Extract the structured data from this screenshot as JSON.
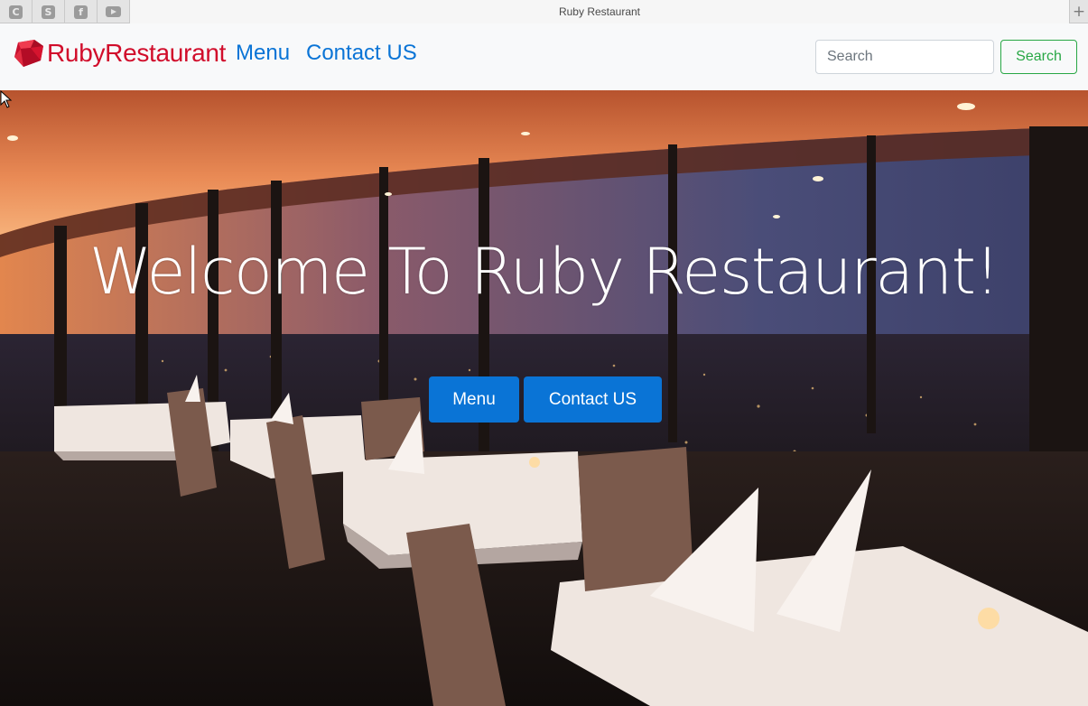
{
  "browser": {
    "tab_title": "Ruby Restaurant",
    "pinned_tabs": [
      {
        "icon": "c-square-icon",
        "glyph": "C"
      },
      {
        "icon": "s-square-icon",
        "glyph": "S"
      },
      {
        "icon": "facebook-icon",
        "glyph": "f"
      },
      {
        "icon": "youtube-icon",
        "glyph": ""
      }
    ],
    "new_tab_glyph": "+"
  },
  "navbar": {
    "brand": "RubyRestaurant",
    "brand_icon": "ruby-gem-icon",
    "links": [
      "Menu",
      "Contact US"
    ],
    "search": {
      "placeholder": "Search",
      "value": "",
      "button_label": "Search"
    }
  },
  "hero": {
    "title": "Welcome To Ruby Restaurant!",
    "buttons": [
      "Menu",
      "Contact US"
    ]
  },
  "colors": {
    "brand_red": "#d10d2b",
    "link_blue": "#0a74d6",
    "button_blue": "#0a74d6",
    "search_green": "#28a745"
  }
}
